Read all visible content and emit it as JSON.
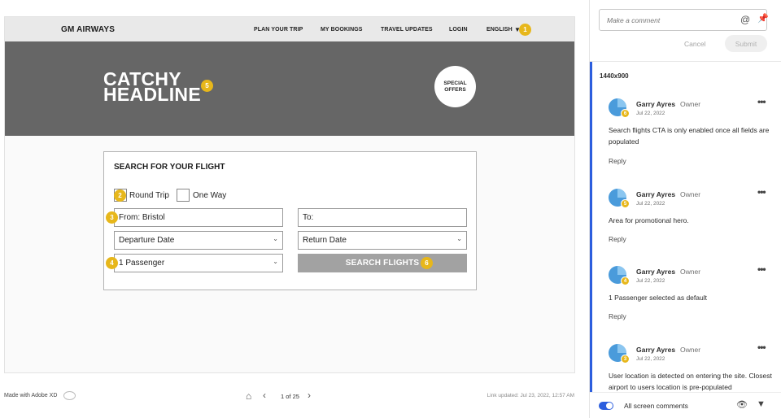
{
  "artboard": {
    "brand": "GM AIRWAYS",
    "nav": [
      "PLAN YOUR TRIP",
      "MY BOOKINGS",
      "TRAVEL UPDATES",
      "LOGIN",
      "ENGLISH"
    ],
    "nav_caret": "▼",
    "headline_line1": "CATCHY",
    "headline_line2": "HEADLINE",
    "special_line1": "SPECIAL",
    "special_line2": "OFFERS",
    "search": {
      "title": "SEARCH FOR YOUR FLIGHT",
      "round_trip": "Round Trip",
      "one_way": "One Way",
      "from": "From: Bristol",
      "to": "To:",
      "departure": "Departure Date",
      "return": "Return Date",
      "passengers": "1 Passenger",
      "button": "SEARCH FLIGHTS"
    },
    "pins": [
      "1",
      "2",
      "3",
      "4",
      "5",
      "6"
    ],
    "pin_color": "#e7b71b"
  },
  "footer": {
    "made_with": "Made with Adobe XD",
    "page": "1 of 25",
    "link_updated": "Link updated: Jul 23, 2022, 12:57 AM"
  },
  "panel": {
    "placeholder": "Make a comment",
    "cancel": "Cancel",
    "submit": "Submit",
    "artboard_size": "1440x900",
    "comments": [
      {
        "pin": "6",
        "author": "Garry Ayres",
        "role": "Owner",
        "date": "Jul 22, 2022",
        "text": "Search flights CTA is only enabled once all fields are populated",
        "reply": "Reply"
      },
      {
        "pin": "5",
        "author": "Garry Ayres",
        "role": "Owner",
        "date": "Jul 22, 2022",
        "text": "Area for promotional hero.",
        "reply": "Reply"
      },
      {
        "pin": "4",
        "author": "Garry Ayres",
        "role": "Owner",
        "date": "Jul 22, 2022",
        "text": "1 Passenger selected as default",
        "reply": "Reply"
      },
      {
        "pin": "3",
        "author": "Garry Ayres",
        "role": "Owner",
        "date": "Jul 22, 2022",
        "text": "User location is detected on entering the site. Closest airport to users location is pre-populated",
        "reply": ""
      }
    ],
    "all_screen_comments": "All screen comments",
    "accent": "#2c5ede"
  }
}
